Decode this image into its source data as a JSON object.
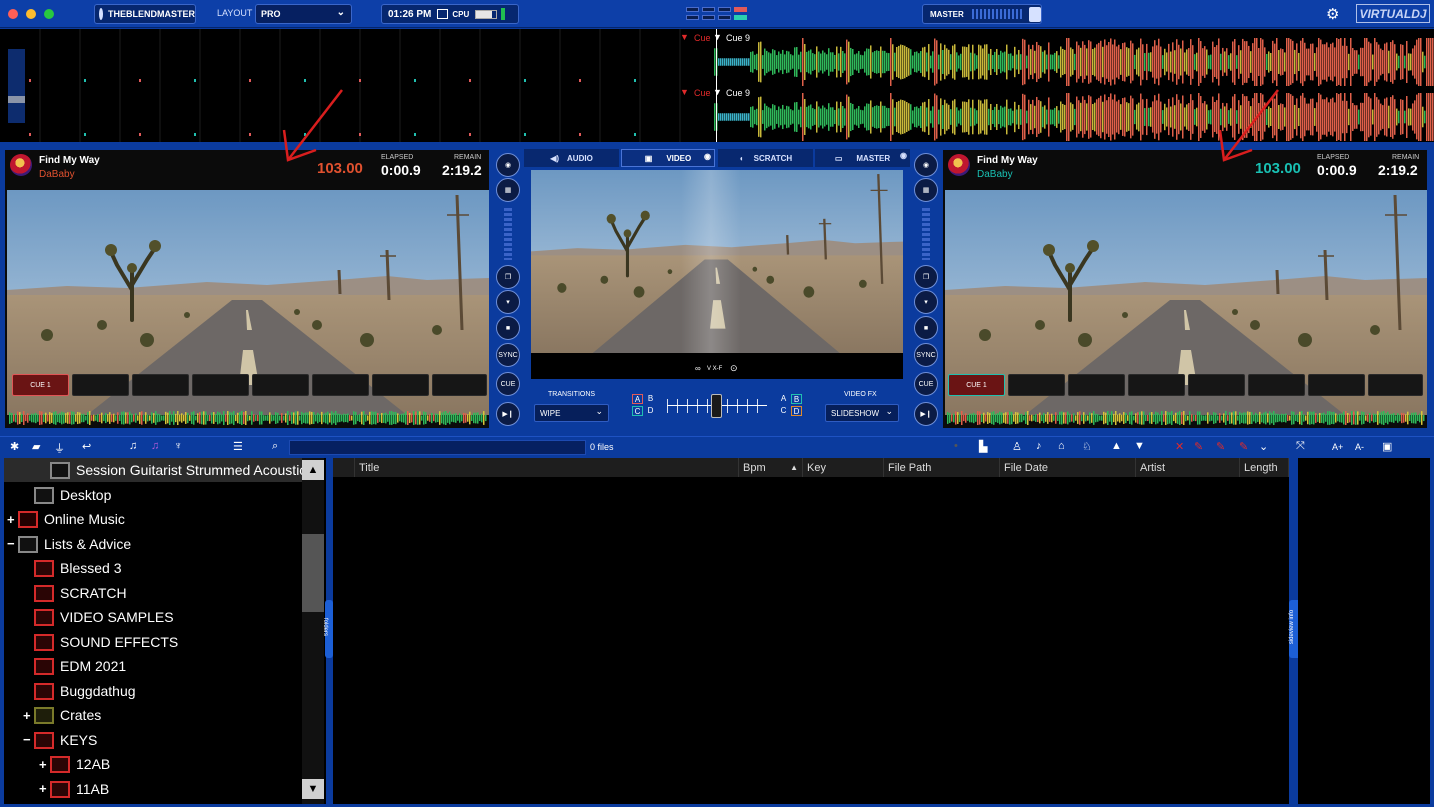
{
  "topbar": {
    "user": "THEBLENDMASTER",
    "layout_label": "LAYOUT",
    "layout_value": "PRO",
    "clock": "01:26 PM",
    "cpu_label": "CPU",
    "master_label": "MASTER",
    "brand": "VIRTUALDJ"
  },
  "overview": {
    "cue_label": "Cue",
    "cue9_label": "Cue 9"
  },
  "deck_left": {
    "title": "Find My Way",
    "artist": "DaBaby",
    "bpm": "103.00",
    "elapsed_label": "ELAPSED",
    "elapsed": "0:00.9",
    "remain_label": "REMAIN",
    "remain": "2:19.2",
    "pad1": "CUE 1",
    "accent": "#e0512f"
  },
  "deck_right": {
    "title": "Find My Way",
    "artist": "DaBaby",
    "bpm": "103.00",
    "elapsed_label": "ELAPSED",
    "elapsed": "0:00.9",
    "remain_label": "REMAIN",
    "remain": "2:19.2",
    "pad1": "CUE 1",
    "accent": "#19c0b3"
  },
  "side_buttons": {
    "sync": "SYNC",
    "cue": "CUE"
  },
  "center": {
    "tabs": [
      "AUDIO",
      "VIDEO",
      "SCRATCH",
      "MASTER"
    ],
    "vxf_label": "V X-F",
    "transitions_label": "TRANSITIONS",
    "transition_value": "WIPE",
    "videofx_label": "VIDEO FX",
    "videofx_value": "SLIDESHOW",
    "ab_left": [
      "A",
      "B",
      "C",
      "D"
    ],
    "ab_right": [
      "A",
      "B",
      "C",
      "D"
    ]
  },
  "browser": {
    "file_count": "0 files",
    "folders_tab": "folders",
    "sideview_tab": "sideview info"
  },
  "tree": [
    {
      "label": "Session Guitarist Strummed Acoustic",
      "icon": "folder-gray"
    },
    {
      "label": "Desktop",
      "icon": "desktop"
    },
    {
      "label": "Online Music",
      "icon": "globe",
      "expander": "+"
    },
    {
      "label": "Lists & Advice",
      "icon": "list",
      "expander": "−"
    },
    {
      "label": "Blessed 3",
      "icon": "playlist"
    },
    {
      "label": "SCRATCH",
      "icon": "playlist"
    },
    {
      "label": "VIDEO SAMPLES",
      "icon": "playlist"
    },
    {
      "label": "SOUND EFFECTS",
      "icon": "playlist"
    },
    {
      "label": "EDM 2021",
      "icon": "playlist"
    },
    {
      "label": "Buggdathug",
      "icon": "playlist"
    },
    {
      "label": "Crates",
      "icon": "crate",
      "expander": "+"
    },
    {
      "label": "KEYS",
      "icon": "playlist",
      "expander": "−"
    },
    {
      "label": "12AB",
      "icon": "playlist",
      "expander": "+"
    },
    {
      "label": "11AB",
      "icon": "playlist",
      "expander": "+"
    }
  ],
  "columns": [
    "Title",
    "Bpm",
    "Key",
    "File Path",
    "File Date",
    "Artist",
    "Length"
  ]
}
